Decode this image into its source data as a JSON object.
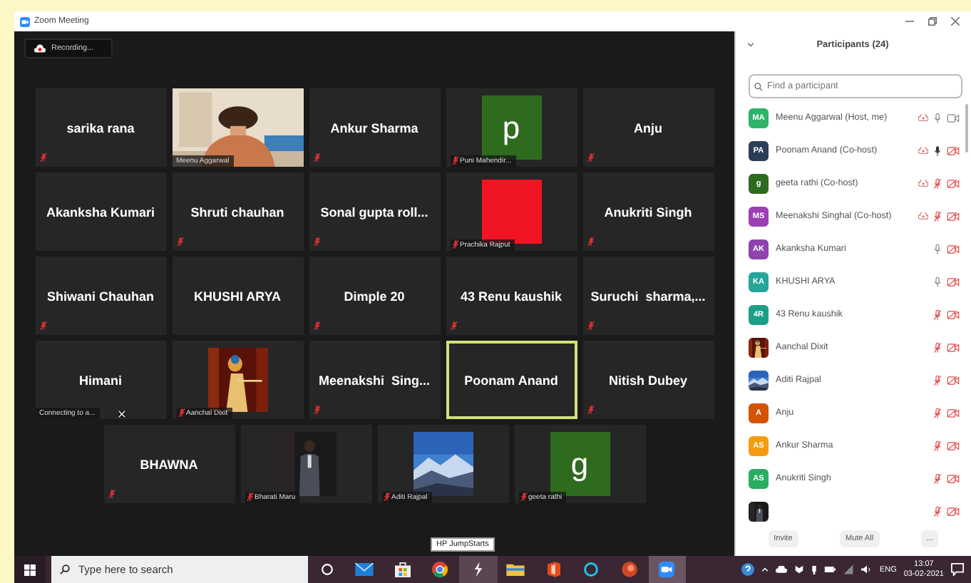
{
  "window": {
    "title": "Zoom Meeting"
  },
  "meeting": {
    "recording_label": "Recording...",
    "rows": [
      [
        {
          "kind": "name",
          "name": "sarika rana",
          "muted": true,
          "active": false
        },
        {
          "kind": "video",
          "name": "Meenu Aggarwal",
          "muted": false,
          "active": false
        },
        {
          "kind": "name",
          "name": "Ankur Sharma",
          "muted": true,
          "active": false
        },
        {
          "kind": "letter",
          "letter": "p",
          "color": "#2f6b1f",
          "name": "Puni Mahendir...",
          "muted": true,
          "active": false
        },
        {
          "kind": "name",
          "name": "Anju",
          "muted": true,
          "active": false
        }
      ],
      [
        {
          "kind": "name",
          "name": "Akanksha Kumari",
          "muted": false,
          "active": false
        },
        {
          "kind": "name",
          "name": "Shruti chauhan",
          "muted": true,
          "active": false
        },
        {
          "kind": "name",
          "name": "Sonal gupta roll...",
          "muted": true,
          "active": false
        },
        {
          "kind": "color",
          "color": "#f01424",
          "name": "Prachika Rajput",
          "muted": true,
          "active": false
        },
        {
          "kind": "name",
          "name": "Anukriti Singh",
          "muted": true,
          "active": false
        }
      ],
      [
        {
          "kind": "name",
          "name": "Shiwani Chauhan",
          "muted": true,
          "active": false
        },
        {
          "kind": "name",
          "name": "KHUSHI ARYA",
          "muted": false,
          "active": false
        },
        {
          "kind": "name",
          "name": "Dimple 20",
          "muted": true,
          "active": false
        },
        {
          "kind": "name",
          "name": "43 Renu kaushik",
          "muted": true,
          "active": false
        },
        {
          "kind": "name",
          "name": "Suruchi  sharma,...",
          "muted": true,
          "active": false
        }
      ],
      [
        {
          "kind": "name",
          "name": "Himani",
          "muted": false,
          "active": false,
          "status": "Connecting to a..."
        },
        {
          "kind": "picture",
          "name": "Aanchal Dixit",
          "muted": true,
          "active": false
        },
        {
          "kind": "name",
          "name": "Meenakshi  Sing...",
          "muted": true,
          "active": false
        },
        {
          "kind": "name",
          "name": "Poonam Anand",
          "muted": false,
          "active": true
        },
        {
          "kind": "name",
          "name": "Nitish Dubey",
          "muted": true,
          "active": false
        }
      ],
      [
        {
          "kind": "name",
          "name": "BHAWNA",
          "muted": true,
          "active": false
        },
        {
          "kind": "picture",
          "name": "Bharati Maru",
          "muted": true,
          "active": false
        },
        {
          "kind": "picture",
          "name": "Aditi Rajpal",
          "muted": true,
          "active": false
        },
        {
          "kind": "letter",
          "letter": "g",
          "color": "#2f6b1f",
          "name": "geeta rathi",
          "muted": true,
          "active": false
        }
      ]
    ]
  },
  "participants": {
    "title": "Participants (24)",
    "search_placeholder": "Find a participant",
    "rows": [
      {
        "name": "Meenu Aggarwal (Host, me)",
        "kind": "initials",
        "initials": "MA",
        "color": "#2fb36b",
        "cloud": true,
        "mic_muted": false,
        "speaking": false,
        "video_on": true
      },
      {
        "name": "Poonam Anand (Co-host)",
        "kind": "initials",
        "initials": "PA",
        "color": "#2c3e57",
        "cloud": true,
        "mic_muted": false,
        "speaking": true,
        "video_on": false
      },
      {
        "name": "geeta rathi (Co-host)",
        "kind": "initials",
        "initials": "g",
        "color": "#2f6b1f",
        "cloud": true,
        "mic_muted": true,
        "video_on": false
      },
      {
        "name": "Meenakshi Singhal (Co-host)",
        "kind": "initials",
        "initials": "MS",
        "color": "#9b3fb5",
        "cloud": true,
        "mic_muted": true,
        "video_on": false
      },
      {
        "name": "Akanksha Kumari",
        "kind": "initials",
        "initials": "AK",
        "color": "#8e44ad",
        "cloud": false,
        "mic_muted": false,
        "speaking": false,
        "video_on": false
      },
      {
        "name": "KHUSHI ARYA",
        "kind": "initials",
        "initials": "KA",
        "color": "#26a69a",
        "cloud": false,
        "mic_muted": false,
        "speaking": false,
        "video_on": false
      },
      {
        "name": "43 Renu kaushik",
        "kind": "initials",
        "initials": "4R",
        "color": "#1e9e88",
        "cloud": false,
        "mic_muted": true,
        "video_on": false
      },
      {
        "name": "Aanchal Dixit",
        "kind": "picture",
        "cloud": false,
        "mic_muted": true,
        "video_on": false
      },
      {
        "name": "Aditi Rajpal",
        "kind": "picture",
        "cloud": false,
        "mic_muted": true,
        "video_on": false
      },
      {
        "name": "Anju",
        "kind": "initials",
        "initials": "A",
        "color": "#d35400",
        "cloud": false,
        "mic_muted": true,
        "video_on": false
      },
      {
        "name": "Ankur Sharma",
        "kind": "initials",
        "initials": "AS",
        "color": "#f39c12",
        "cloud": false,
        "mic_muted": true,
        "video_on": false
      },
      {
        "name": "Anukriti Singh",
        "kind": "initials",
        "initials": "AS",
        "color": "#27ae60",
        "cloud": false,
        "mic_muted": true,
        "video_on": false
      },
      {
        "kind": "picture",
        "cloud": false,
        "mic_muted": true,
        "video_on": false
      }
    ],
    "buttons": [
      "Invite",
      "Mute All",
      "..."
    ]
  },
  "taskbar": {
    "search_placeholder": "Type here to search",
    "apps": [
      {
        "kind": "cortana",
        "hovered": false,
        "active": false
      },
      {
        "kind": "mail",
        "hovered": false,
        "active": false
      },
      {
        "kind": "store",
        "hovered": false,
        "active": false
      },
      {
        "kind": "browser",
        "hovered": false,
        "active": false
      },
      {
        "kind": "bolt",
        "hovered": true,
        "active": false,
        "tooltip": "HP JumpStarts"
      },
      {
        "kind": "folder",
        "hovered": false,
        "active": false
      },
      {
        "kind": "office",
        "hovered": false,
        "active": false
      },
      {
        "kind": "ring",
        "hovered": false,
        "active": false
      },
      {
        "kind": "slides",
        "hovered": false,
        "active": false
      },
      {
        "kind": "zoom",
        "hovered": false,
        "active": true
      }
    ],
    "language": "ENG",
    "time": "13:07",
    "date": "03-02-2021"
  }
}
